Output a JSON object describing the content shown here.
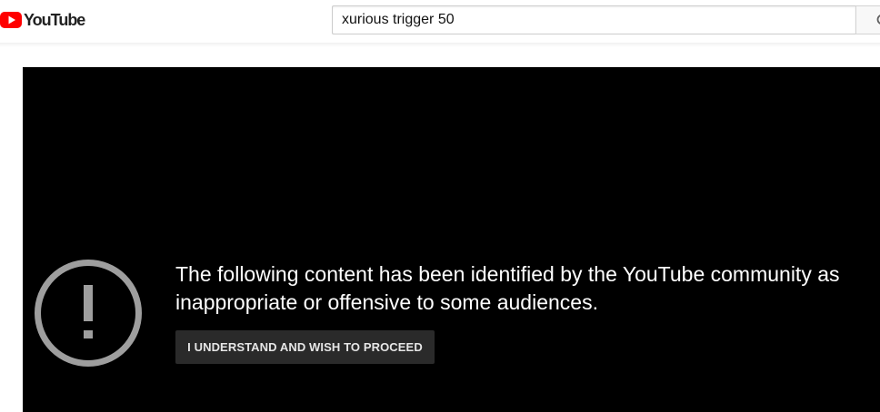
{
  "masthead": {
    "logo_text": "YouTube",
    "search": {
      "value": "xurious trigger 50"
    }
  },
  "player": {
    "warning_message": "The following content has been identified by the YouTube community as inappropriate or offensive to some audiences.",
    "proceed_button_label": "I UNDERSTAND AND WISH TO PROCEED"
  },
  "colors": {
    "brand_red": "#ff0000",
    "player_background": "#000000",
    "button_background": "#2a2a2a",
    "icon_gray": "#9e9e9e"
  },
  "icons": {
    "logo": "youtube-play-icon",
    "search": "search-icon",
    "warning": "exclamation-circle-icon"
  }
}
